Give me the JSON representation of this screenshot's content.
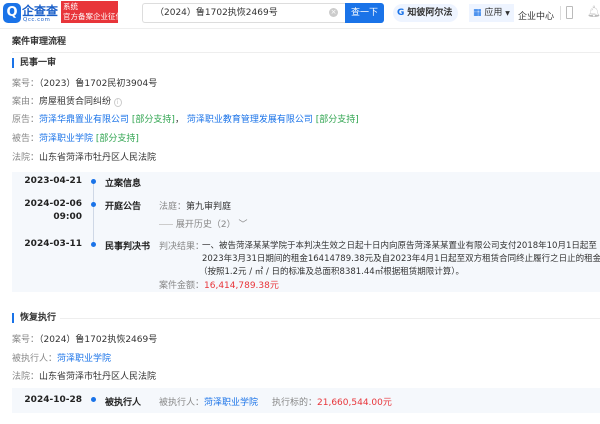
{
  "header": {
    "logo_text": "企查查",
    "logo_sub": "Qcc.com",
    "badge_line1": "系统",
    "badge_line2": "官方备案企业征信",
    "search_value": "（2024）鲁1702执恢2469号",
    "search_button": "查一下",
    "alpha_label": "知彼阿尔法",
    "apps_label": "应用",
    "enterprise_center": "企业中心"
  },
  "page_title": "案件审理流程",
  "first_trial": {
    "heading": "民事一审",
    "case_no_label": "案号：",
    "case_no": "（2023）鲁1702民初3904号",
    "cause_label": "案由：",
    "cause": "房屋租赁合同纠纷",
    "plaintiff_label": "原告：",
    "plaintiffs": [
      {
        "name": "菏泽华鼎置业有限公司",
        "tag": "[部分支持]"
      },
      {
        "name": "菏泽职业教育管理发展有限公司",
        "tag": "[部分支持]"
      }
    ],
    "plaintiff_sep": "，",
    "defendant_label": "被告：",
    "defendant": "菏泽职业学院",
    "defendant_tag": "[部分支持]",
    "court_label": "法院：",
    "court": "山东省菏泽市牡丹区人民法院",
    "timeline": [
      {
        "date": "2023-04-21",
        "event": "立案信息"
      },
      {
        "date": "2024-02-06",
        "time": "09:00",
        "event": "开庭公告",
        "info_label": "法庭：",
        "info": "第九审判庭",
        "expand": "展开历史（2）"
      },
      {
        "date": "2024-03-11",
        "event": "民事判决书",
        "result_label": "判决结果：",
        "result_lines": [
          "一、被告菏泽某某学院于本判决生效之日起十日内向原告菏泽某某置业有限公司支付2018年10月1日起至",
          "2023年3月31日期间的租金16414789.38元及自2023年4月1日起至双方租赁合同终止履行之日止的租金",
          "（按照1.2元 / ㎡ / 日的标准及总面积8381.44㎡根据租赁期限计算）。"
        ],
        "amount_label": "案件金额：",
        "amount": "16,414,789.38元"
      }
    ]
  },
  "resume_exec": {
    "heading": "恢复执行",
    "case_no_label": "案号：",
    "case_no": "（2024）鲁1702执恢2469号",
    "executed_label": "被执行人：",
    "executed": "菏泽职业学院",
    "court_label": "法院：",
    "court": "山东省菏泽市牡丹区人民法院",
    "timeline": [
      {
        "date": "2024-10-28",
        "event": "被执行人",
        "person_label": "被执行人：",
        "person": "菏泽职业学院",
        "target_label": "执行标的：",
        "target": "21,660,544.00元"
      }
    ]
  },
  "colors": {
    "accent": "#1a73e8",
    "red": "#e8353a",
    "green": "#2fa44f"
  }
}
